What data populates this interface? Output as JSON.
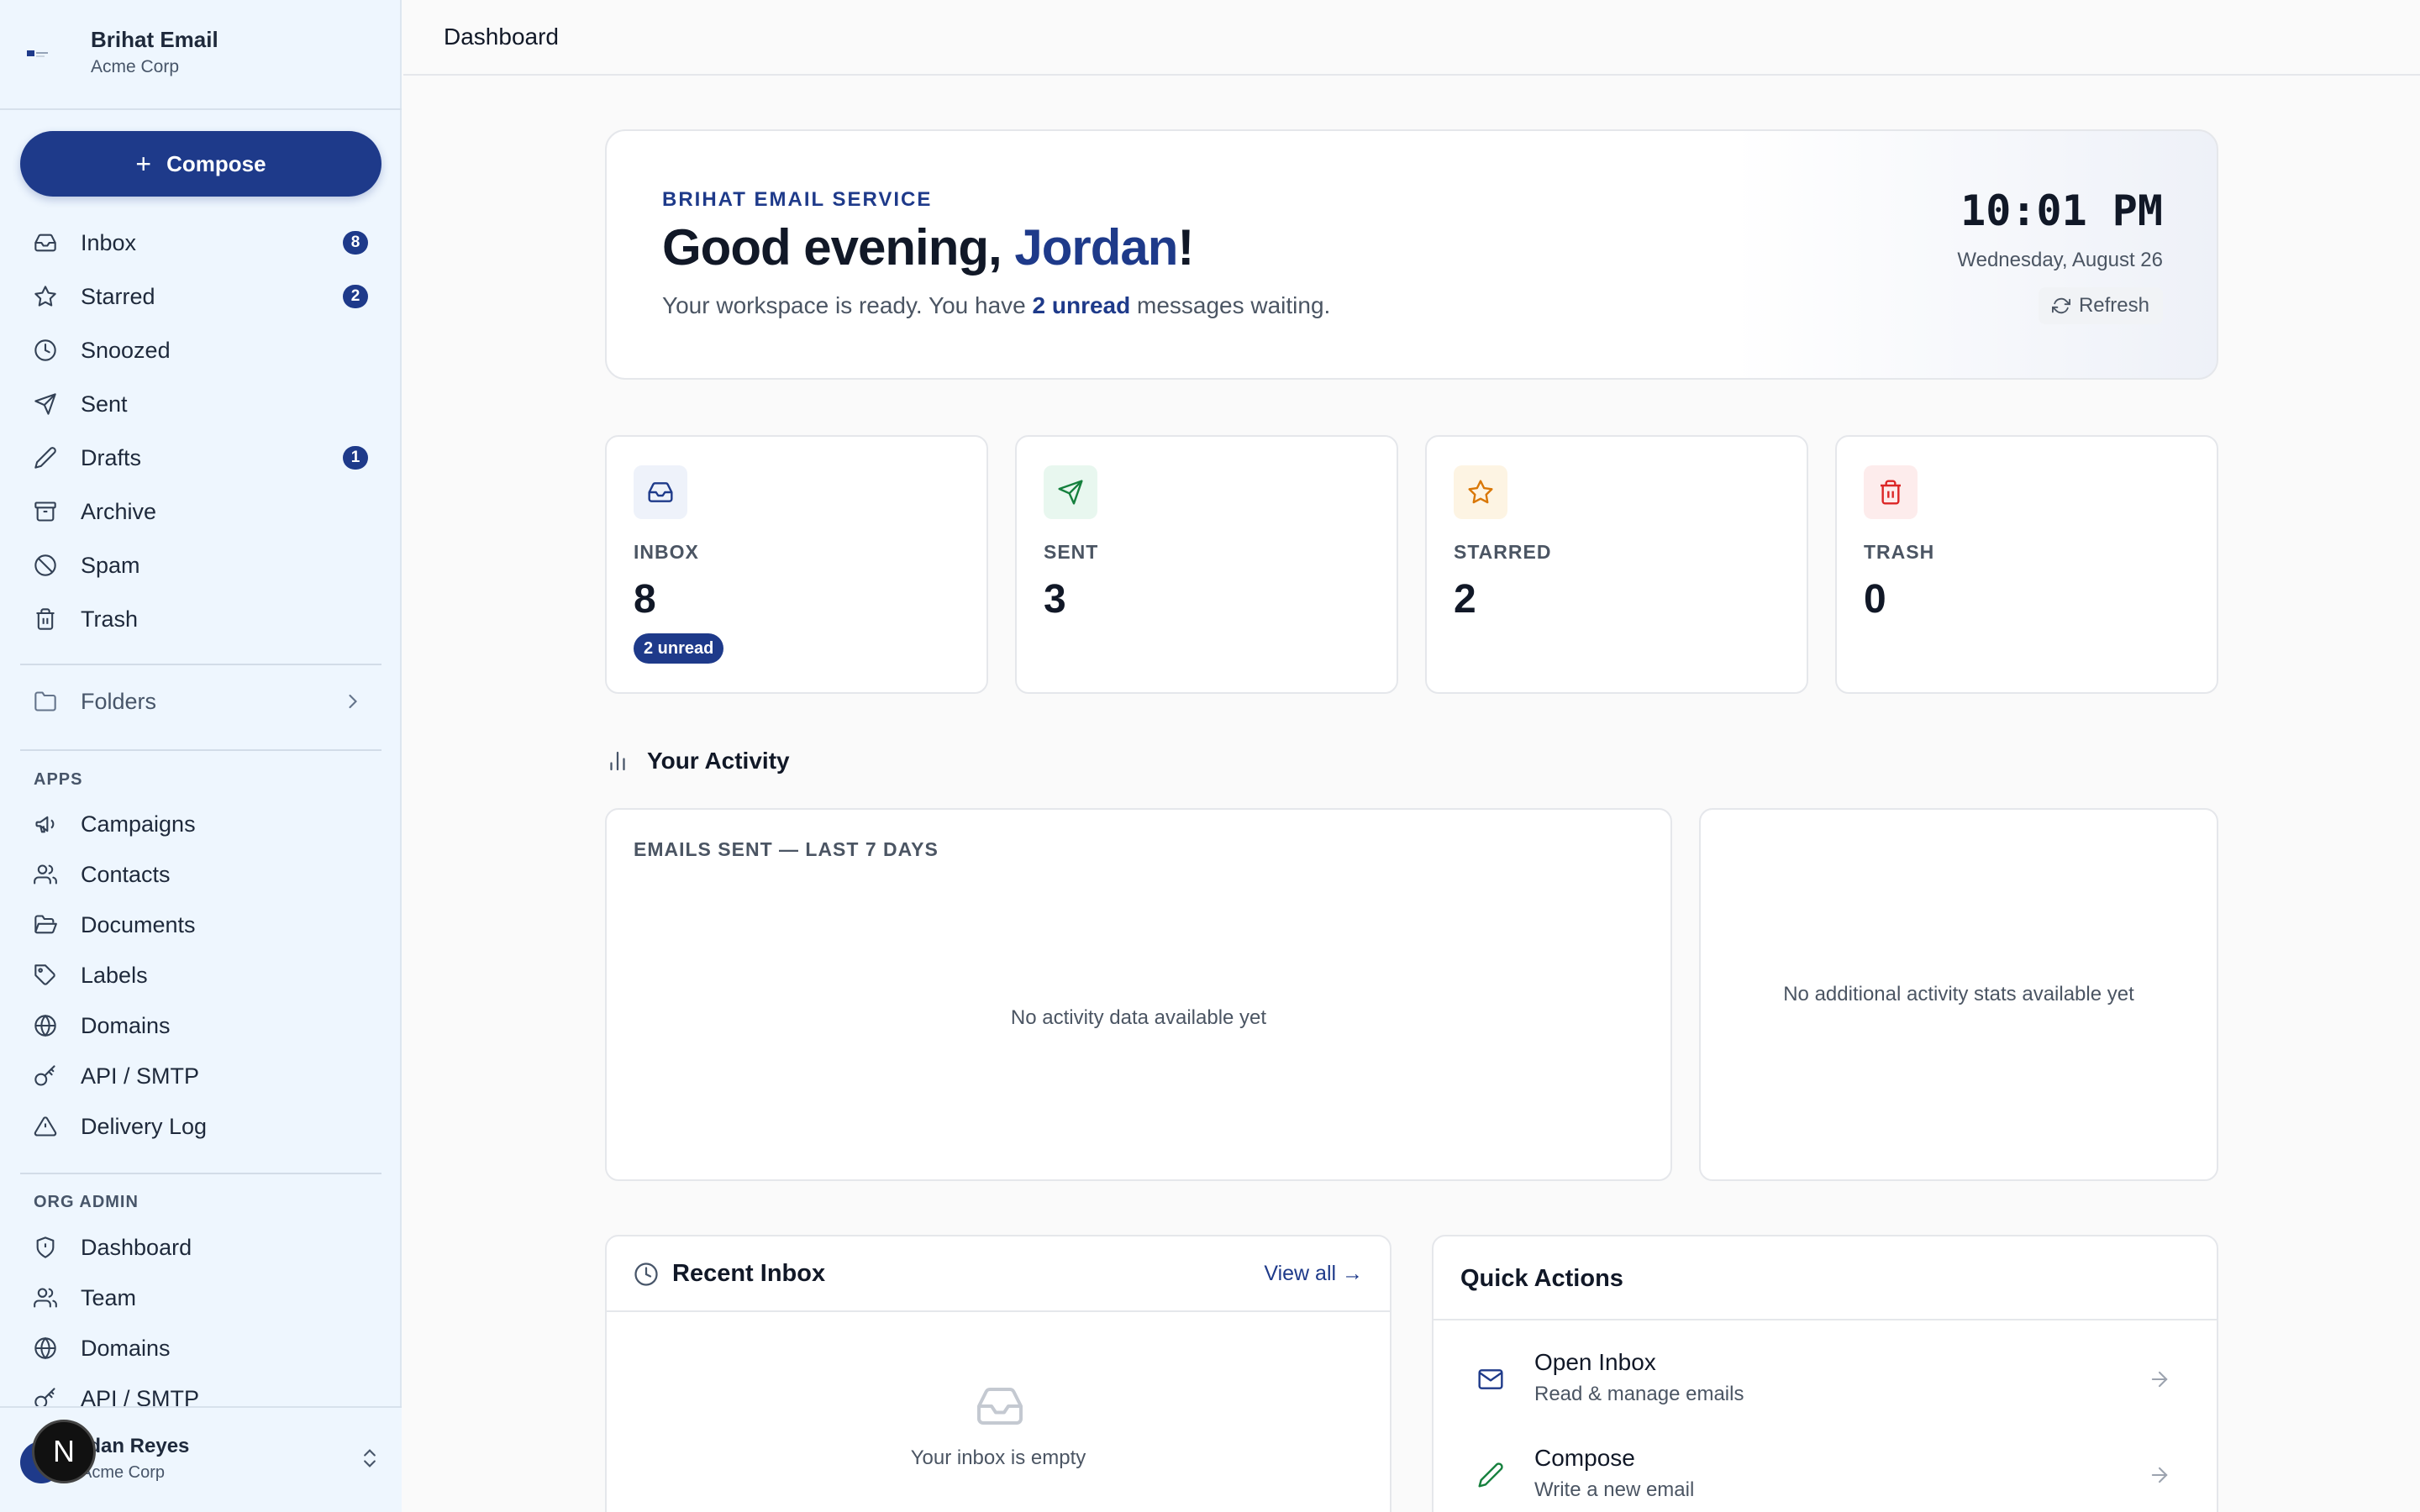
{
  "brand": {
    "name": "Brihat Email",
    "org": "Acme Corp"
  },
  "compose_label": "Compose",
  "nav": {
    "mail": [
      {
        "label": "Inbox",
        "badge": "8",
        "icon": "inbox-icon"
      },
      {
        "label": "Starred",
        "badge": "2",
        "icon": "star-icon"
      },
      {
        "label": "Snoozed",
        "badge": "",
        "icon": "clock-icon"
      },
      {
        "label": "Sent",
        "badge": "",
        "icon": "send-icon"
      },
      {
        "label": "Drafts",
        "badge": "1",
        "icon": "pencil-icon"
      },
      {
        "label": "Archive",
        "badge": "",
        "icon": "archive-icon"
      },
      {
        "label": "Spam",
        "badge": "",
        "icon": "ban-icon"
      },
      {
        "label": "Trash",
        "badge": "",
        "icon": "trash-icon"
      }
    ],
    "folders_label": "Folders",
    "apps_heading": "APPS",
    "apps": [
      {
        "label": "Campaigns",
        "icon": "megaphone-icon"
      },
      {
        "label": "Contacts",
        "icon": "users-icon"
      },
      {
        "label": "Documents",
        "icon": "folder-open-icon"
      },
      {
        "label": "Labels",
        "icon": "tag-icon"
      },
      {
        "label": "Domains",
        "icon": "globe-icon"
      },
      {
        "label": "API / SMTP",
        "icon": "key-icon"
      },
      {
        "label": "Delivery Log",
        "icon": "alert-triangle-icon"
      }
    ],
    "org_admin_heading": "ORG ADMIN",
    "org_admin": [
      {
        "label": "Dashboard",
        "icon": "shield-icon"
      },
      {
        "label": "Team",
        "icon": "users-icon"
      },
      {
        "label": "Domains",
        "icon": "globe-icon"
      },
      {
        "label": "API / SMTP",
        "icon": "key-icon"
      }
    ]
  },
  "user": {
    "name": "Jordan Reyes",
    "name_visible": "rdan Reyes",
    "org": "Acme Corp",
    "overlay_letter": "N"
  },
  "header": {
    "title": "Dashboard"
  },
  "hero": {
    "eyebrow": "BRIHAT EMAIL SERVICE",
    "greeting_prefix": "Good evening, ",
    "greeting_name": "Jordan",
    "greeting_suffix": "!",
    "sub_prefix": "Your workspace is ready. You have ",
    "sub_strong": "2 unread",
    "sub_suffix": " messages waiting.",
    "time": "10:01 PM",
    "date": "Wednesday, August 26",
    "refresh_label": "Refresh"
  },
  "stats": [
    {
      "label": "INBOX",
      "value": "8",
      "badge": "2 unread",
      "icon": "inbox-icon",
      "bg": "#eef2fa",
      "fg": "#1e3a8a"
    },
    {
      "label": "SENT",
      "value": "3",
      "badge": "",
      "icon": "send-icon",
      "bg": "#e8f7ef",
      "fg": "#15803d"
    },
    {
      "label": "STARRED",
      "value": "2",
      "badge": "",
      "icon": "star-icon",
      "bg": "#fdf4e3",
      "fg": "#d97706"
    },
    {
      "label": "TRASH",
      "value": "0",
      "badge": "",
      "icon": "trash-icon",
      "bg": "#fdecec",
      "fg": "#dc2626"
    }
  ],
  "activity": {
    "title": "Your Activity",
    "chart_title": "EMAILS SENT — LAST 7 DAYS",
    "chart_empty": "No activity data available yet",
    "stats_empty": "No additional activity stats available yet"
  },
  "recent_inbox": {
    "title": "Recent Inbox",
    "view_all": "View all →",
    "empty": "Your inbox is empty"
  },
  "quick_actions": {
    "title": "Quick Actions",
    "items": [
      {
        "name": "Open Inbox",
        "desc": "Read & manage emails",
        "icon": "mail-icon"
      },
      {
        "name": "Compose",
        "desc": "Write a new email",
        "icon": "pencil-icon"
      }
    ]
  }
}
